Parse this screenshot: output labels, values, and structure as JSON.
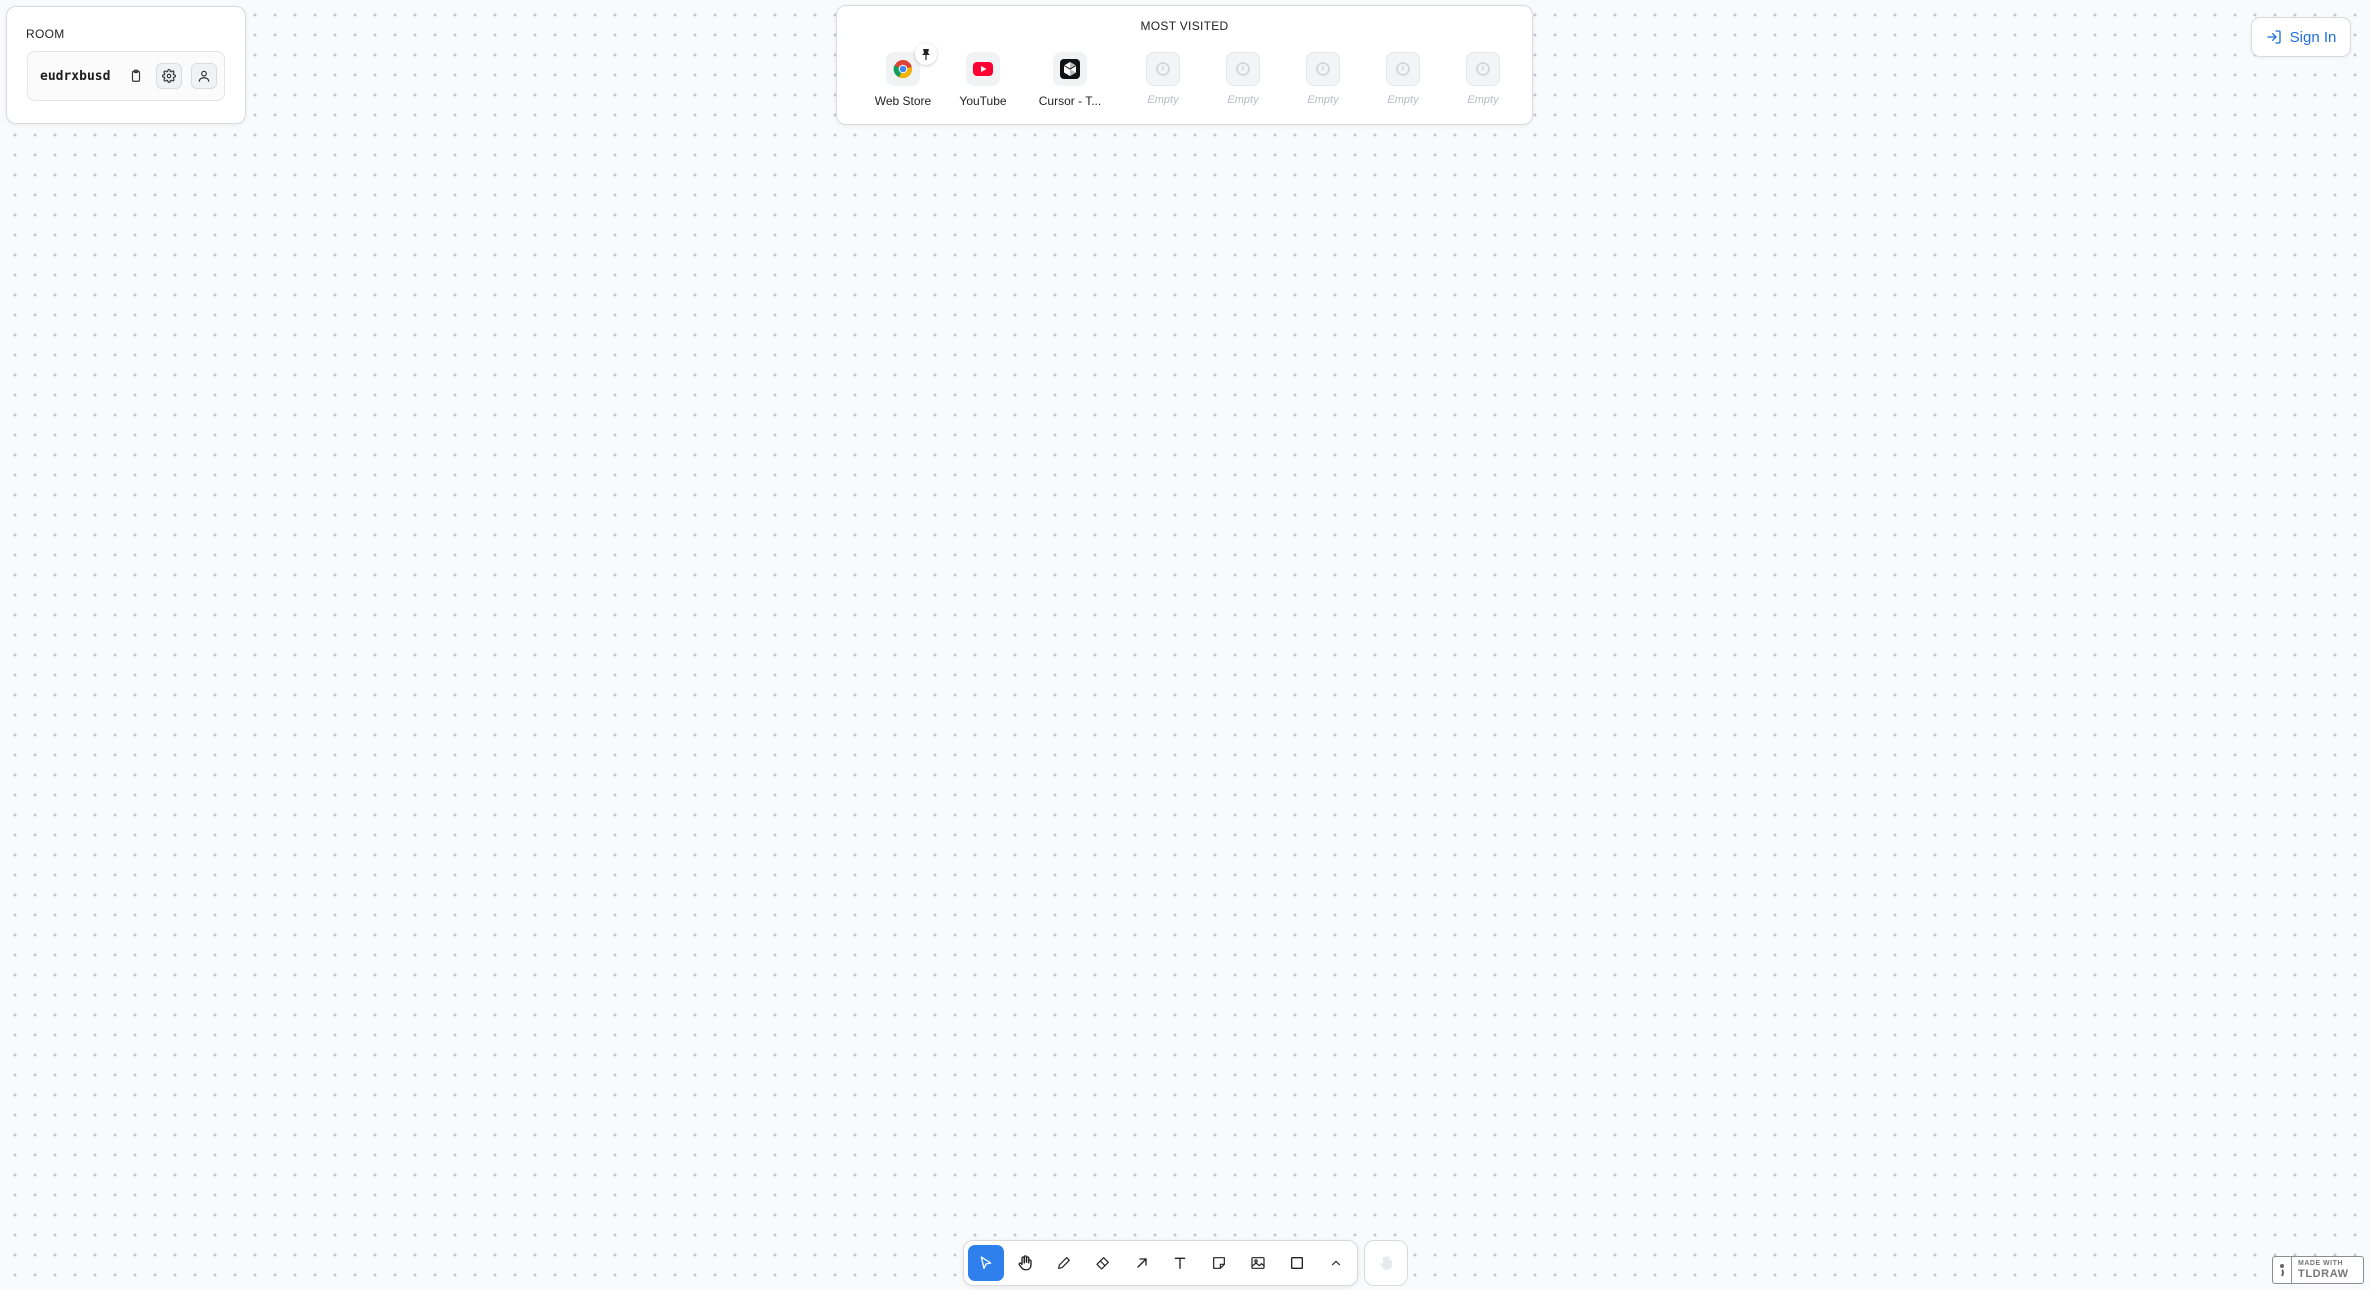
{
  "room": {
    "label": "ROOM",
    "code": "eudrxbusd"
  },
  "most_visited": {
    "title": "MOST VISITED",
    "tiles": [
      {
        "name": "Web Store",
        "icon": "chrome-icon",
        "pinned": true
      },
      {
        "name": "YouTube",
        "icon": "youtube-icon"
      },
      {
        "name": "Cursor - T...",
        "icon": "cursor-app-icon"
      },
      {
        "name": "Empty",
        "icon": "empty-slot-icon"
      },
      {
        "name": "Empty",
        "icon": "empty-slot-icon"
      },
      {
        "name": "Empty",
        "icon": "empty-slot-icon"
      },
      {
        "name": "Empty",
        "icon": "empty-slot-icon"
      },
      {
        "name": "Empty",
        "icon": "empty-slot-icon"
      }
    ]
  },
  "header": {
    "sign_in_label": "Sign In"
  },
  "toolbar": {
    "tools": [
      "select",
      "hand",
      "draw",
      "eraser",
      "arrow",
      "text",
      "note",
      "asset",
      "rectangle",
      "more"
    ],
    "active_tool": "select"
  },
  "badge": {
    "line1": "MADE WITH",
    "line2": "TLDRAW"
  },
  "colors": {
    "accent": "#2f80ed",
    "link": "#1e6fd9",
    "youtube_red": "#ff0033"
  }
}
